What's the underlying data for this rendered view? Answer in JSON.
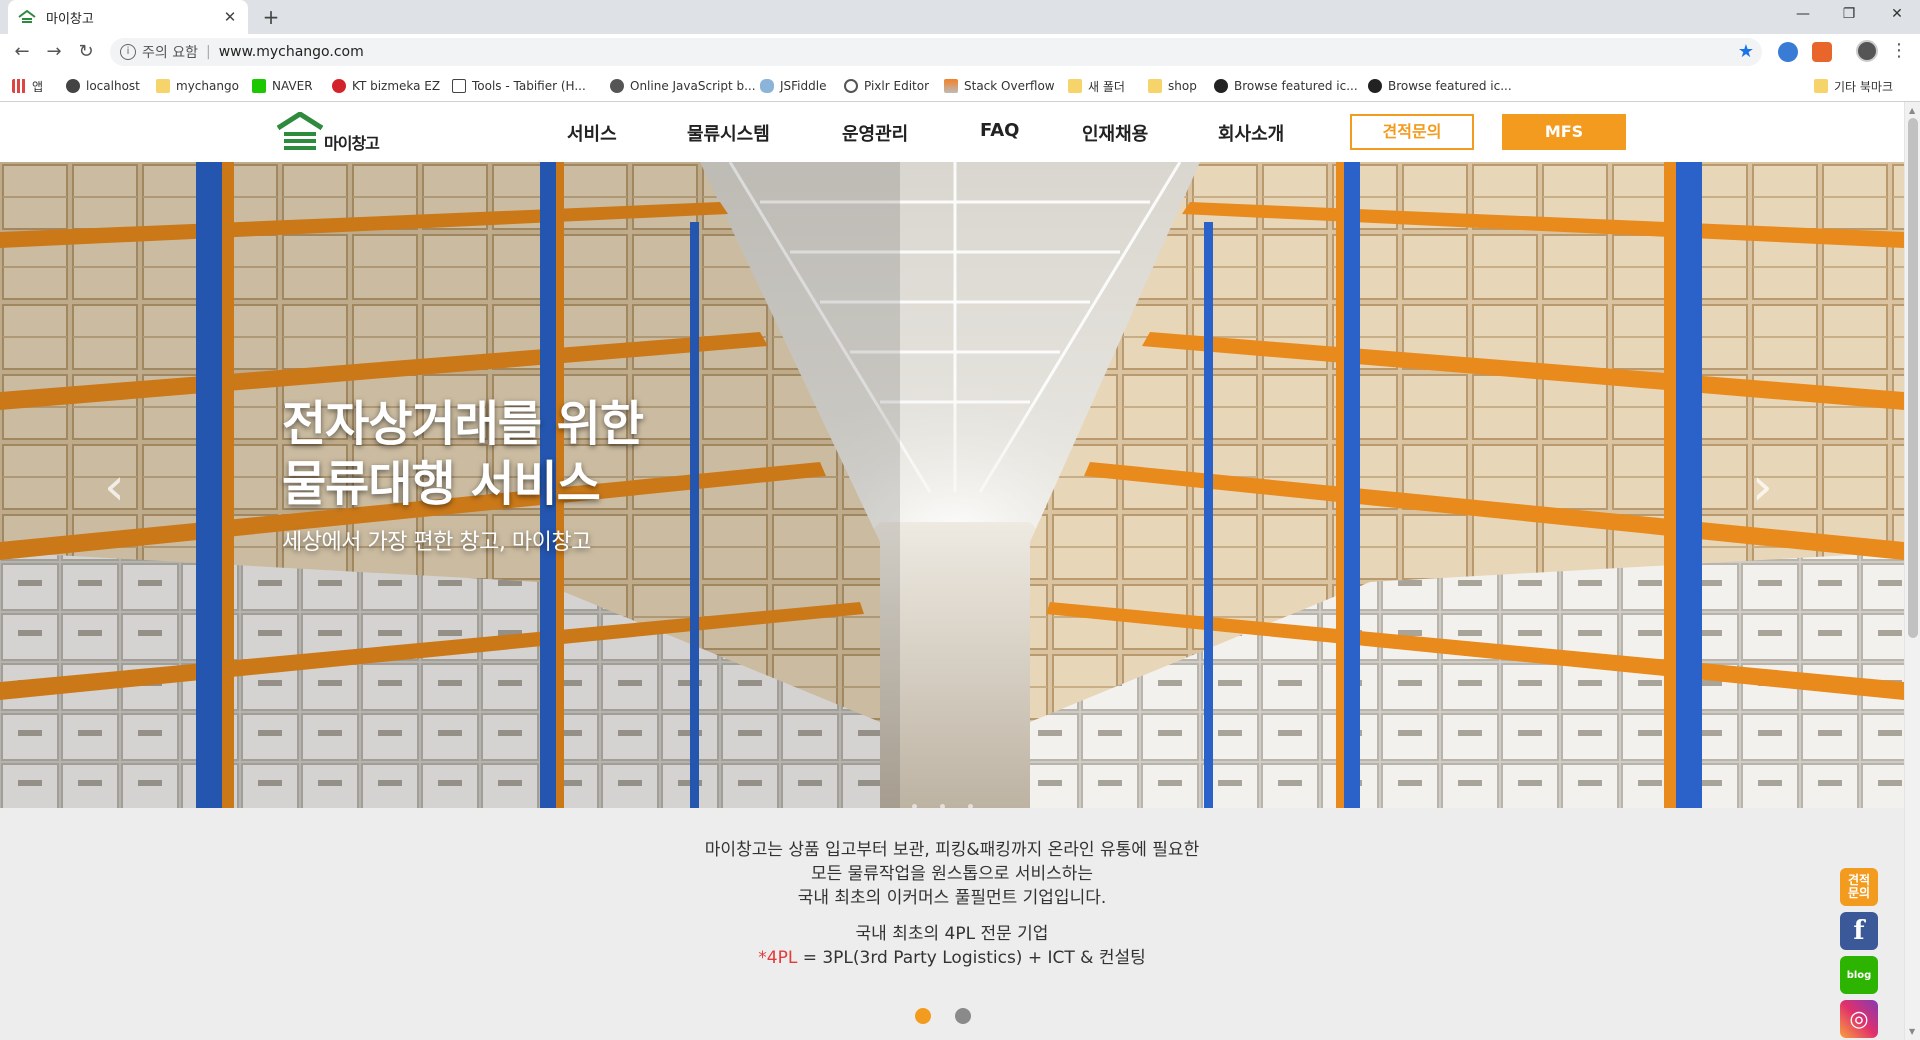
{
  "browser": {
    "tab_title": "마이창고",
    "new_tab": "+",
    "security_label": "주의 요함",
    "url": "www.mychango.com",
    "bookmarks": [
      {
        "label": "앱"
      },
      {
        "label": "localhost"
      },
      {
        "label": "mychango"
      },
      {
        "label": "NAVER"
      },
      {
        "label": "KT bizmeka EZ"
      },
      {
        "label": "Tools - Tabifier (H..."
      },
      {
        "label": "Online JavaScript b..."
      },
      {
        "label": "JSFiddle"
      },
      {
        "label": "Pixlr Editor"
      },
      {
        "label": "Stack Overflow"
      },
      {
        "label": "새 폴더"
      },
      {
        "label": "shop"
      },
      {
        "label": "Browse featured ic..."
      },
      {
        "label": "Browse featured ic..."
      },
      {
        "label": "기타 북마크"
      }
    ]
  },
  "site": {
    "logo_text": "마이창고",
    "nav": [
      "서비스",
      "물류시스템",
      "운영관리",
      "FAQ",
      "인재채용",
      "회사소개"
    ],
    "quote_button": "견적문의",
    "mfs_button": "MFS"
  },
  "hero": {
    "line1": "전자상거래를 위한",
    "line2": "물류대행 서비스",
    "subtitle": "세상에서 가장 편한 창고, 마이창고",
    "prev": "‹",
    "next": "›"
  },
  "intro": {
    "line1": "마이창고는 상품 입고부터 보관, 피킹&패킹까지 온라인 유통에 필요한",
    "line2": "모든 물류작업을 원스톱으로 서비스하는",
    "line3": "국내 최초의 이커머스 풀필먼트 기업입니다.",
    "line4": "국내 최초의 4PL 전문 기업",
    "line5_red": "*4PL",
    "line5_rest": " = 3PL(3rd Party Logistics) + ICT & 컨설팅",
    "active_dot_color": "#f29b1e",
    "inactive_dot_color": "#8a8a8a"
  },
  "side_links": {
    "quote": "견적\n문의",
    "facebook": "f",
    "blog": "blog",
    "instagram": "◎"
  },
  "colors": {
    "accent": "#f29b1e",
    "logo_green": "#2e8b3e"
  }
}
